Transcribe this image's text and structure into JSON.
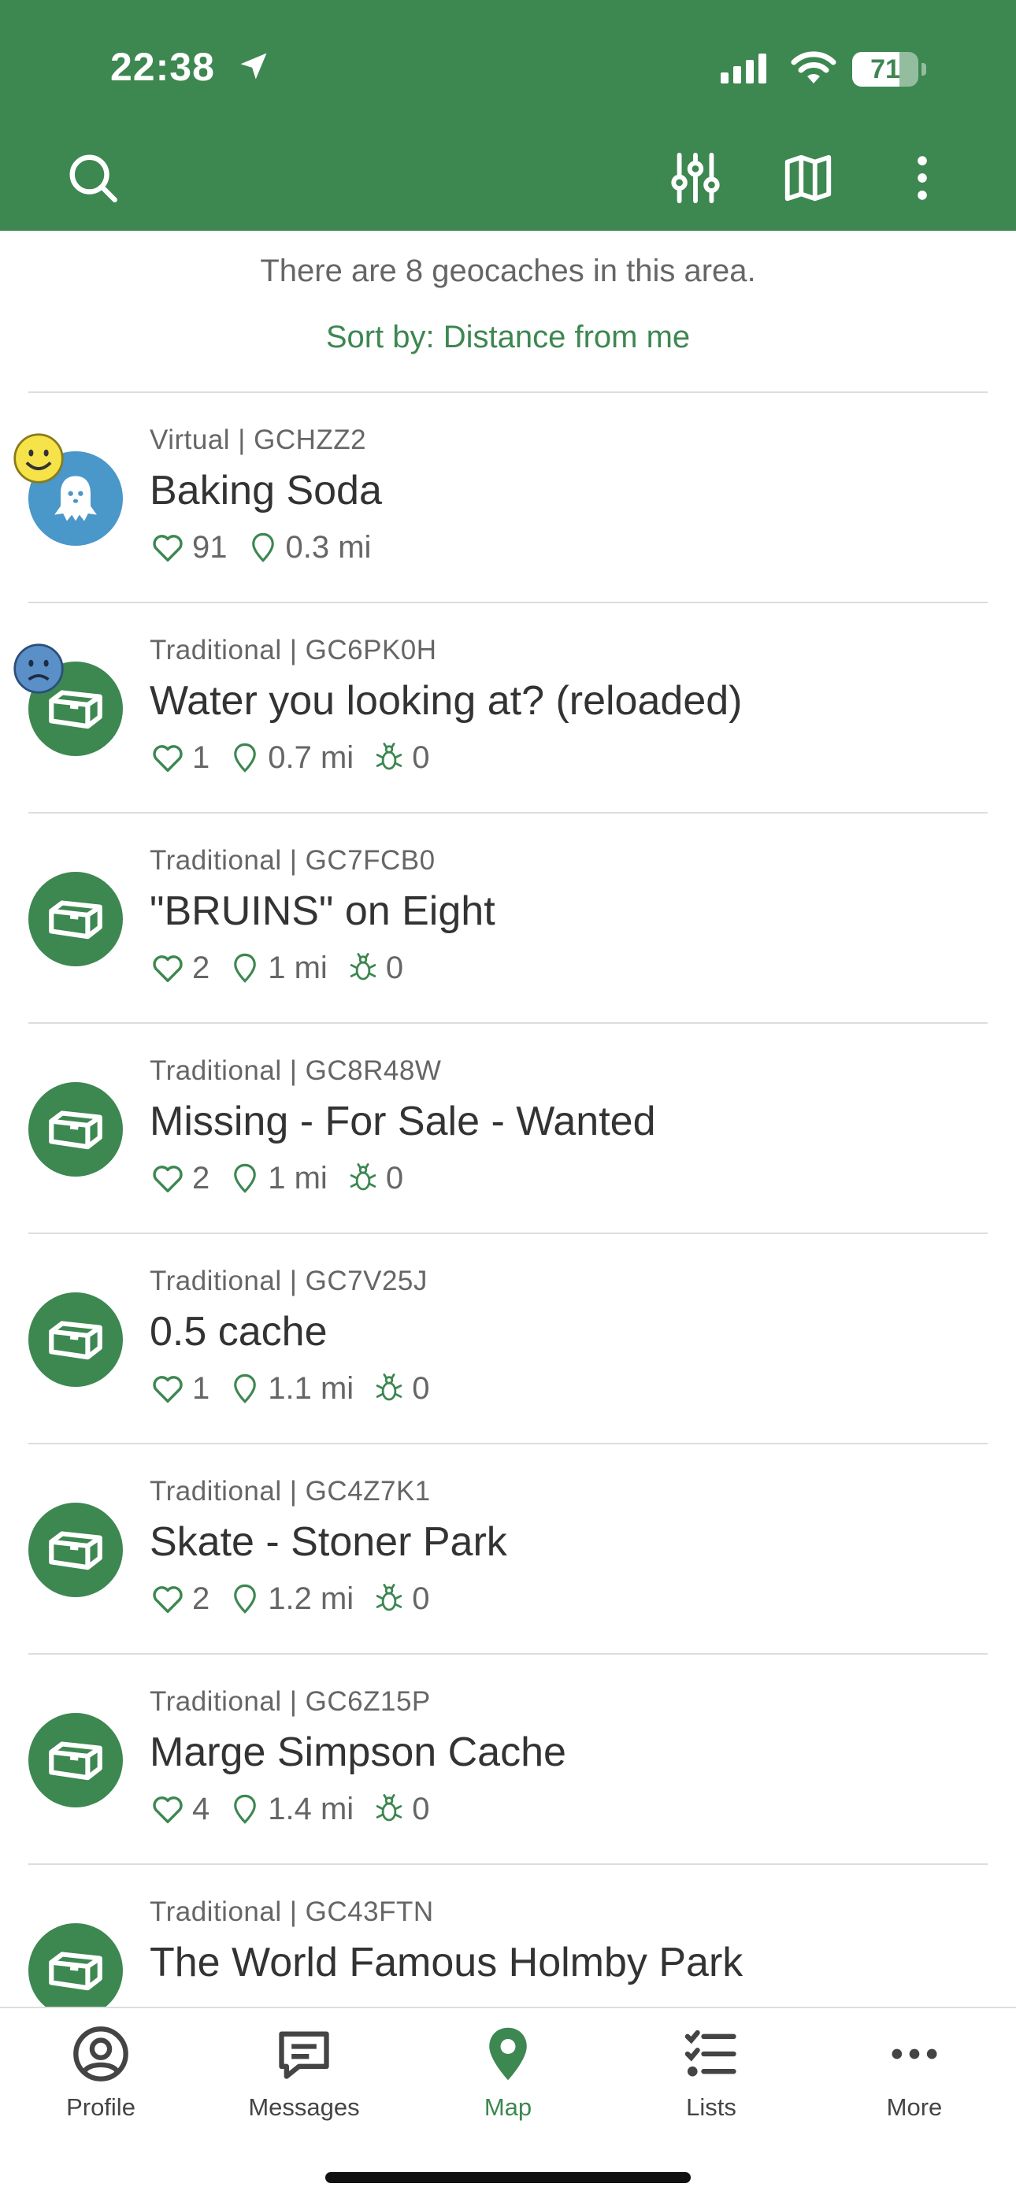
{
  "status_bar": {
    "time": "22:38",
    "battery": "71",
    "battery_level": 0.71
  },
  "header": {
    "search_icon": "search-icon",
    "filter_icon": "sliders-icon",
    "map_icon": "map-icon",
    "more_icon": "more-vertical-icon"
  },
  "info": {
    "count_text": "There are 8 geocaches in this area.",
    "sort_text": "Sort by: Distance from me"
  },
  "caches": [
    {
      "type": "Virtual",
      "code": "GCHZZ2",
      "meta": "Virtual | GCHZZ2",
      "name": "Baking Soda",
      "favorites": "91",
      "distance": "0.3 mi",
      "trackables": null,
      "badge": "happy"
    },
    {
      "type": "Traditional",
      "code": "GC6PK0H",
      "meta": "Traditional | GC6PK0H",
      "name": "Water you looking at? (reloaded)",
      "favorites": "1",
      "distance": "0.7 mi",
      "trackables": "0",
      "badge": "sad"
    },
    {
      "type": "Traditional",
      "code": "GC7FCB0",
      "meta": "Traditional | GC7FCB0",
      "name": "\"BRUINS\" on Eight",
      "favorites": "2",
      "distance": "1 mi",
      "trackables": "0",
      "badge": null
    },
    {
      "type": "Traditional",
      "code": "GC8R48W",
      "meta": "Traditional | GC8R48W",
      "name": "Missing - For Sale - Wanted",
      "favorites": "2",
      "distance": "1 mi",
      "trackables": "0",
      "badge": null
    },
    {
      "type": "Traditional",
      "code": "GC7V25J",
      "meta": "Traditional | GC7V25J",
      "name": "0.5 cache",
      "favorites": "1",
      "distance": "1.1 mi",
      "trackables": "0",
      "badge": null
    },
    {
      "type": "Traditional",
      "code": "GC4Z7K1",
      "meta": "Traditional | GC4Z7K1",
      "name": "Skate - Stoner Park",
      "favorites": "2",
      "distance": "1.2 mi",
      "trackables": "0",
      "badge": null
    },
    {
      "type": "Traditional",
      "code": "GC6Z15P",
      "meta": "Traditional | GC6Z15P",
      "name": "Marge Simpson Cache",
      "favorites": "4",
      "distance": "1.4 mi",
      "trackables": "0",
      "badge": null
    },
    {
      "type": "Traditional",
      "code": "GC43FTN",
      "meta": "Traditional | GC43FTN",
      "name": "The World Famous Holmby Park",
      "favorites": "",
      "distance": "",
      "trackables": null,
      "badge": null
    }
  ],
  "tabs": [
    {
      "label": "Profile",
      "icon": "profile-icon",
      "active": false
    },
    {
      "label": "Messages",
      "icon": "messages-icon",
      "active": false
    },
    {
      "label": "Map",
      "icon": "map-pin-icon",
      "active": true
    },
    {
      "label": "Lists",
      "icon": "lists-icon",
      "active": false
    },
    {
      "label": "More",
      "icon": "more-horizontal-icon",
      "active": false
    }
  ],
  "colors": {
    "brand_green": "#3d8751",
    "virtual_blue": "#4a97c9",
    "text_gray": "#666666"
  }
}
